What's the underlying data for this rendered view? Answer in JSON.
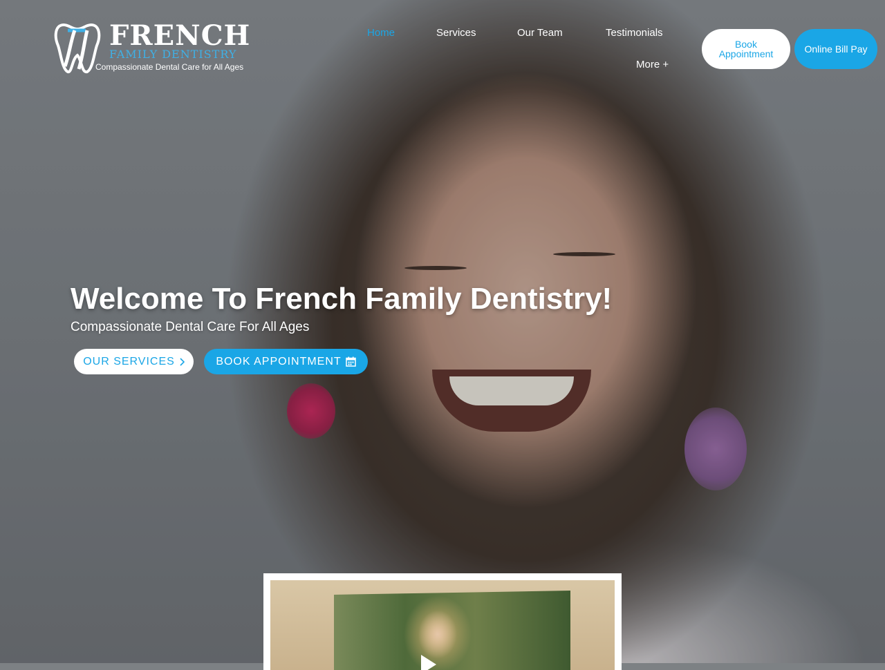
{
  "header": {
    "logo": {
      "title": "FRENCH",
      "subtitle": "FAMILY DENTISTRY",
      "tagline": "Compassionate Dental Care for All Ages"
    },
    "nav": [
      {
        "label": "Home",
        "active": true
      },
      {
        "label": "Services"
      },
      {
        "label": "Our Team"
      },
      {
        "label": "Testimonials"
      },
      {
        "label": "More +"
      }
    ],
    "book_button": "Book Appointment",
    "bill_button": "Online Bill Pay"
  },
  "hero": {
    "title": "Welcome To French Family Dentistry!",
    "subtitle": "Compassionate Dental Care For All Ages",
    "services_button": "OUR SERVICES",
    "appointment_button": "BOOK APPOINTMENT"
  },
  "colors": {
    "accent": "#1aa6e6"
  },
  "icons": {
    "chevron": "chevron-right-icon",
    "calendar": "calendar-icon",
    "play": "play-icon"
  }
}
